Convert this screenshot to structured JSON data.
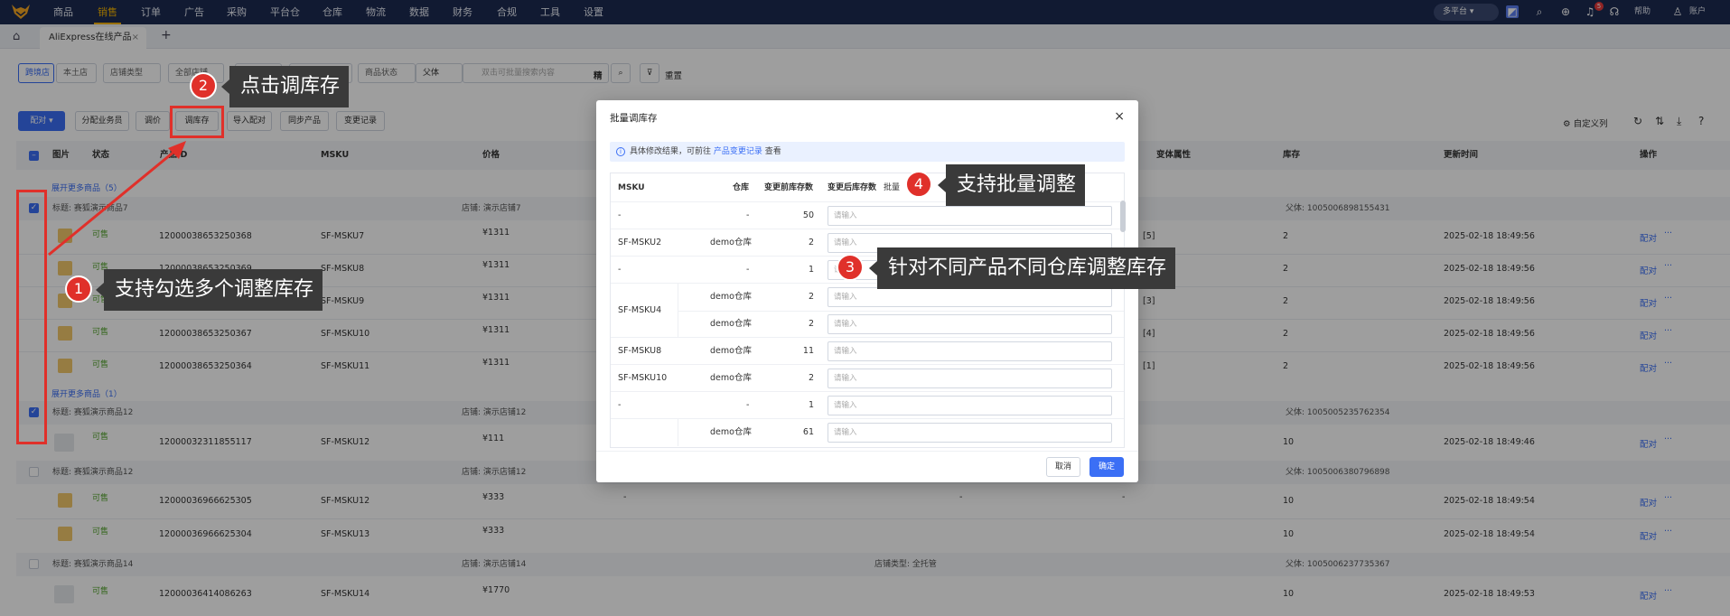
{
  "topnav": {
    "items": [
      "商品",
      "销售",
      "订单",
      "广告",
      "采购",
      "平台仓",
      "仓库",
      "物流",
      "数据",
      "财务",
      "合规",
      "工具",
      "设置"
    ],
    "active_index": 1,
    "platform_label": "多平台",
    "notification_count": "5",
    "help_label": "帮助",
    "account_label": "账户",
    "accent_color": "#f5b400",
    "bg_color": "#1c2a52"
  },
  "tabbar": {
    "home_icon": "home-icon",
    "tab_label": "AliExpress在线产品",
    "close": "×",
    "add": "+"
  },
  "filters": {
    "seg_a": "跨境店",
    "seg_b": "本土店",
    "shop_type": "店铺类型",
    "all_shops": "全部店铺",
    "s3": "标签",
    "s4": "全部",
    "s5": "商品状态",
    "field": "父体",
    "search_placeholder": "双击可批量搜索内容",
    "exact": "精",
    "reset": "重置"
  },
  "toolbar": {
    "pair": "配对",
    "assign": "分配业务员",
    "adjust_price": "调价",
    "adjust_stock": "调库存",
    "import_pair": "导入配对",
    "sync": "同步产品",
    "change_log": "变更记录",
    "custom_cols": "自定义列"
  },
  "table": {
    "headers": {
      "image": "图片",
      "status": "状态",
      "product_id": "产品ID",
      "msku": "MSKU",
      "price": "价格",
      "attrs": "变体属性",
      "stock": "库存",
      "updated": "更新时间",
      "ops": "操作"
    },
    "expand1": "展开更多商品（5）",
    "group1": {
      "title": "标题: 赛狐演示商品7",
      "shop": "店铺: 演示店铺7",
      "parent": "父体: 1005006898155431"
    },
    "rows1": [
      {
        "status": "可售",
        "id": "12000038653250368",
        "msku": "SF-MSKU7",
        "price": "¥1311",
        "attr": "[5]",
        "stock": "2",
        "time": "2025-02-18 18:49:56"
      },
      {
        "status": "可售",
        "id": "12000038653250369",
        "msku": "SF-MSKU8",
        "price": "¥1311",
        "attr": "",
        "stock": "2",
        "time": "2025-02-18 18:49:56"
      },
      {
        "status": "可售",
        "id": "12000038653250366",
        "msku": "SF-MSKU9",
        "price": "¥1311",
        "attr": "[3]",
        "stock": "2",
        "time": "2025-02-18 18:49:56"
      },
      {
        "status": "可售",
        "id": "12000038653250367",
        "msku": "SF-MSKU10",
        "price": "¥1311",
        "attr": "[4]",
        "stock": "2",
        "time": "2025-02-18 18:49:56"
      },
      {
        "status": "可售",
        "id": "12000038653250364",
        "msku": "SF-MSKU11",
        "price": "¥1311",
        "attr": "[1]",
        "stock": "2",
        "time": "2025-02-18 18:49:56"
      }
    ],
    "expand2": "展开更多商品（1）",
    "group2": {
      "title": "标题: 赛狐演示商品12",
      "shop": "店铺: 演示店铺12",
      "parent": "父体: 1005005235762354"
    },
    "row2": {
      "status": "可售",
      "id": "12000032311855117",
      "msku": "SF-MSKU12",
      "price": "¥111",
      "stock": "10",
      "time": "2025-02-18 18:49:46"
    },
    "group3": {
      "title": "标题: 赛狐演示商品12",
      "shop": "店铺: 演示店铺12",
      "parent": "父体: 1005006380796898"
    },
    "rows3": [
      {
        "status": "可售",
        "id": "12000036966625305",
        "msku": "SF-MSKU12",
        "price": "¥333",
        "stock": "10",
        "time": "2025-02-18 18:49:54"
      },
      {
        "status": "可售",
        "id": "12000036966625304",
        "msku": "SF-MSKU13",
        "price": "¥333",
        "stock": "10",
        "time": "2025-02-18 18:49:54"
      }
    ],
    "group4": {
      "title": "标题: 赛狐演示商品14",
      "shop": "店铺: 演示店铺14",
      "ship": "店铺类型: 全托管",
      "parent": "父体: 1005006237735367"
    },
    "row4": {
      "status": "可售",
      "id": "12000036414086263",
      "msku": "SF-MSKU14",
      "price": "¥1770",
      "stock": "10",
      "time": "2025-02-18 18:49:53"
    },
    "dash": "-",
    "op_pair": "配对",
    "op_more": "···",
    "thumb_label": "赛狐"
  },
  "modal": {
    "title": "批量调库存",
    "info_prefix": "具体修改结果，可前往",
    "info_link": "产品变更记录",
    "info_suffix": "查看",
    "col_msku": "MSKU",
    "col_wh": "仓库",
    "col_before": "变更前库存数",
    "col_after": "变更后库存数",
    "batch": "批量",
    "placeholder": "请输入",
    "rows": [
      {
        "msku": "-",
        "wh": "-",
        "before": "50"
      },
      {
        "msku": "SF-MSKU2",
        "wh": "demo仓库",
        "before": "2"
      },
      {
        "msku": "-",
        "wh": "-",
        "before": "1"
      },
      {
        "msku": "SF-MSKU4",
        "wh": "demo仓库",
        "before": "2"
      },
      {
        "msku": "",
        "wh": "demo仓库",
        "before": "2"
      },
      {
        "msku": "SF-MSKU8",
        "wh": "demo仓库",
        "before": "11"
      },
      {
        "msku": "SF-MSKU10",
        "wh": "demo仓库",
        "before": "2"
      },
      {
        "msku": "-",
        "wh": "-",
        "before": "1"
      },
      {
        "msku": "",
        "wh": "demo仓库",
        "before": "61"
      }
    ],
    "cancel": "取消",
    "confirm": "确定"
  },
  "annotations": {
    "a1": {
      "num": "1",
      "text": "支持勾选多个调整库存"
    },
    "a2": {
      "num": "2",
      "text": "点击调库存"
    },
    "a3": {
      "num": "3",
      "text": "针对不同产品不同仓库调整库存"
    },
    "a4": {
      "num": "4",
      "text": "支持批量调整"
    },
    "color": "#e0302a"
  }
}
